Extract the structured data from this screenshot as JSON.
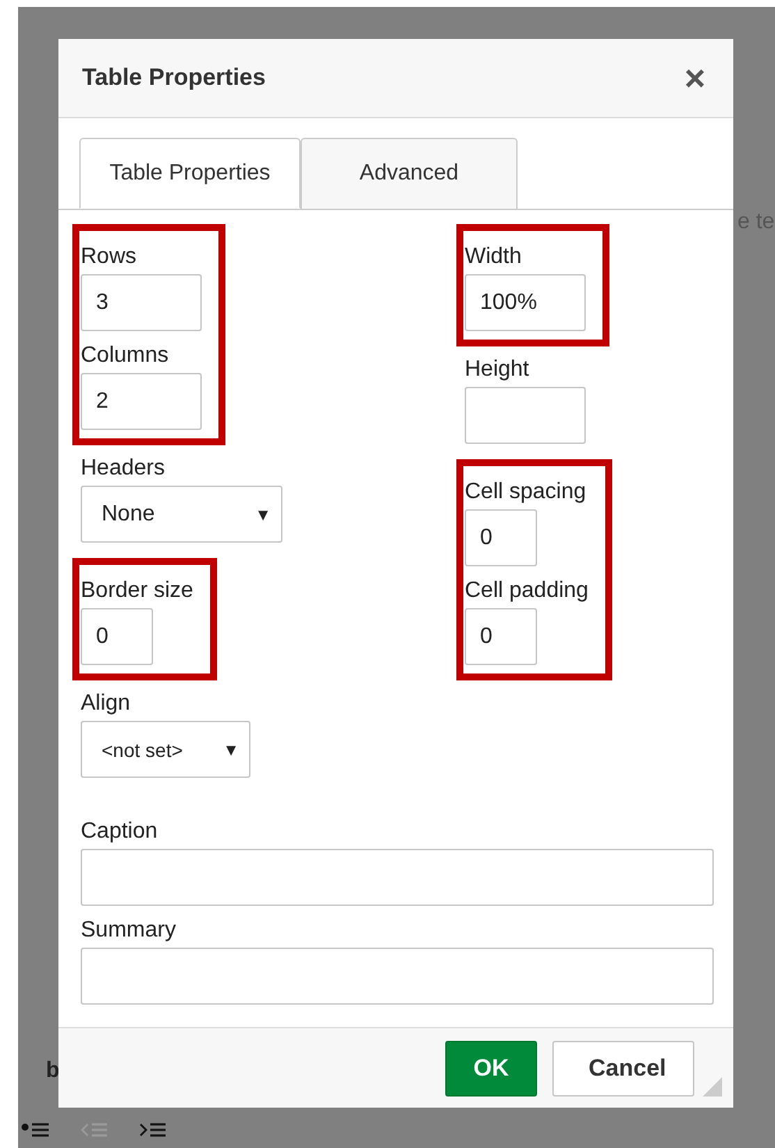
{
  "backdrop": {
    "fragments": [
      {
        "kind": "right",
        "text": "e te"
      },
      {
        "kind": "left",
        "text": "b"
      }
    ],
    "toolbar_icons": [
      {
        "kind": "bullets",
        "disabled": false
      },
      {
        "kind": "outdent",
        "disabled": true
      },
      {
        "kind": "indent",
        "disabled": false
      }
    ]
  },
  "dialog": {
    "title": "Table Properties",
    "close": "×"
  },
  "tabs": [
    {
      "label": "Table Properties",
      "selected": true
    },
    {
      "label": "Advanced",
      "selected": false
    }
  ],
  "left_groups": [
    {
      "highlighted": true,
      "fields": [
        {
          "label": "Rows",
          "kind": "text",
          "value": "3"
        },
        {
          "label": "Columns",
          "kind": "text",
          "value": "2"
        }
      ]
    },
    {
      "highlighted": false,
      "fields": [
        {
          "label": "Headers",
          "kind": "select",
          "value": "None",
          "caret": "▼"
        }
      ]
    },
    {
      "highlighted": true,
      "fields": [
        {
          "label": "Border size",
          "kind": "short_text",
          "value": "0"
        }
      ]
    },
    {
      "highlighted": false,
      "fields": [
        {
          "label": "Align",
          "kind": "short_select",
          "value": "<not set>",
          "caret": "▼"
        }
      ]
    }
  ],
  "right_groups": [
    {
      "highlighted": true,
      "fields": [
        {
          "label": "Width",
          "kind": "text",
          "value": "100%"
        }
      ]
    },
    {
      "highlighted": false,
      "fields": [
        {
          "label": "Height",
          "kind": "text"
        }
      ]
    },
    {
      "highlighted": true,
      "fields": [
        {
          "label": "Cell spacing",
          "kind": "short_text",
          "value": "0"
        },
        {
          "label": "Cell padding",
          "kind": "short_text",
          "value": "0"
        }
      ]
    }
  ],
  "wide_fields": [
    {
      "label": "Caption"
    },
    {
      "label": "Summary"
    }
  ],
  "buttons": [
    {
      "label": "OK",
      "kind": "primary"
    },
    {
      "label": "Cancel",
      "kind": "secondary"
    }
  ]
}
